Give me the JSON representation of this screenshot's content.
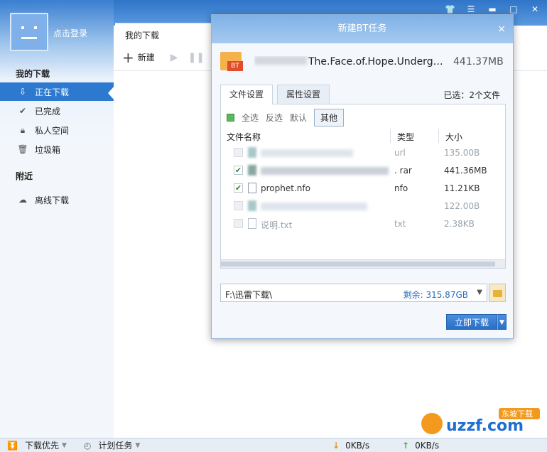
{
  "window": {
    "controls": [
      "shirt-icon",
      "menu-icon",
      "minimize-icon",
      "maximize-icon",
      "close-icon"
    ]
  },
  "sidebar": {
    "login": "点击登录",
    "section_downloads": "我的下载",
    "items": [
      {
        "label": "正在下载",
        "icon": "download-icon",
        "active": true
      },
      {
        "label": "已完成",
        "icon": "check-icon",
        "active": false
      },
      {
        "label": "私人空间",
        "icon": "lock-icon",
        "active": false
      },
      {
        "label": "垃圾箱",
        "icon": "trash-icon",
        "active": false
      }
    ],
    "section_nearby": "附近",
    "offline": "离线下载"
  },
  "main": {
    "tab": "我的下载",
    "new_button": "新建"
  },
  "statusbar": {
    "priority": "下载优先",
    "schedule": "计划任务",
    "download_speed": "0KB/s",
    "upload_speed": "0KB/s"
  },
  "dialog": {
    "title": "新建BT任务",
    "close": "×",
    "torrent_badge": "BT",
    "torrent_name": "The.Face.of.Hope.Undergro...",
    "torrent_size": "441.37MB",
    "tabs": [
      "文件设置",
      "属性设置"
    ],
    "selected": "已选：2个文件",
    "filters": {
      "all": "全选",
      "invert": "反选",
      "default": "默认",
      "other": "其他"
    },
    "columns": {
      "name": "文件名称",
      "type": "类型",
      "size": "大小"
    },
    "files": [
      {
        "name": "",
        "type": "url",
        "size": "135.00B",
        "checked": false,
        "blurred": true
      },
      {
        "name": "",
        "type": ". rar",
        "size": "441.36MB",
        "checked": true,
        "blurred": true
      },
      {
        "name": "prophet.nfo",
        "type": "nfo",
        "size": "11.21KB",
        "checked": true,
        "blurred": false
      },
      {
        "name": "",
        "type": "",
        "size": "122.00B",
        "checked": false,
        "blurred": true
      },
      {
        "name": "说明.txt",
        "type": "txt",
        "size": "2.38KB",
        "checked": false,
        "blurred": false
      }
    ],
    "path": "F:\\迅雷下载\\",
    "free_space": "剩余: 315.87GB",
    "download_button": "立即下载"
  },
  "watermark": {
    "text": "uzzf.com",
    "badge": "东坡下载"
  }
}
